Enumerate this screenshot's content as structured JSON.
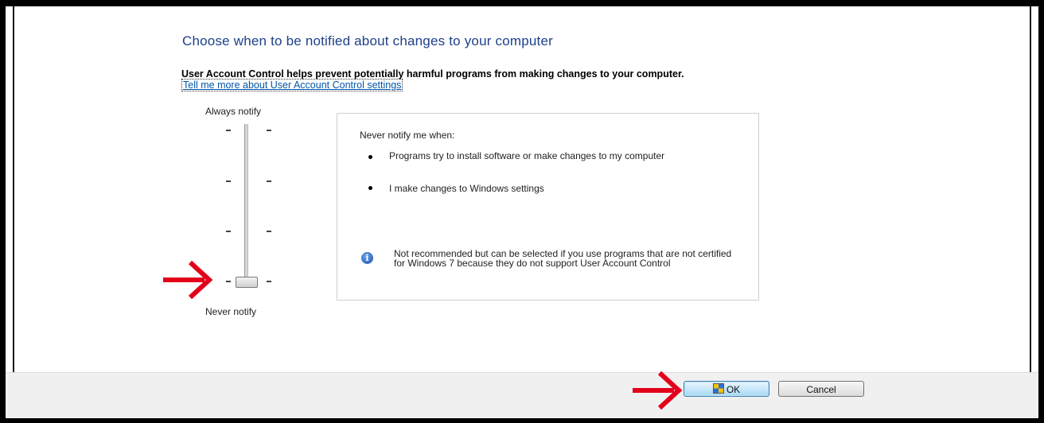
{
  "dialog": {
    "title": "Choose when to be notified about changes to your computer",
    "description": "User Account Control helps prevent potentially harmful programs from making changes to your computer.",
    "more_link": "Tell me more about User Account Control settings"
  },
  "slider": {
    "top_label": "Always notify",
    "bottom_label": "Never notify",
    "level_count": 4,
    "selected_level": 1
  },
  "panel": {
    "heading": "Never notify me when:",
    "bullets": [
      "Programs try to install software or make changes to my computer",
      "I make changes to Windows settings"
    ],
    "info_text": "Not recommended but can be selected if you use programs that are not certified for Windows 7 because they do not support User Account Control",
    "info_icon": "info-icon"
  },
  "buttons": {
    "ok": "OK",
    "cancel": "Cancel",
    "ok_icon": "shield-icon"
  },
  "annotations": {
    "arrow_color": "#e3001b"
  }
}
